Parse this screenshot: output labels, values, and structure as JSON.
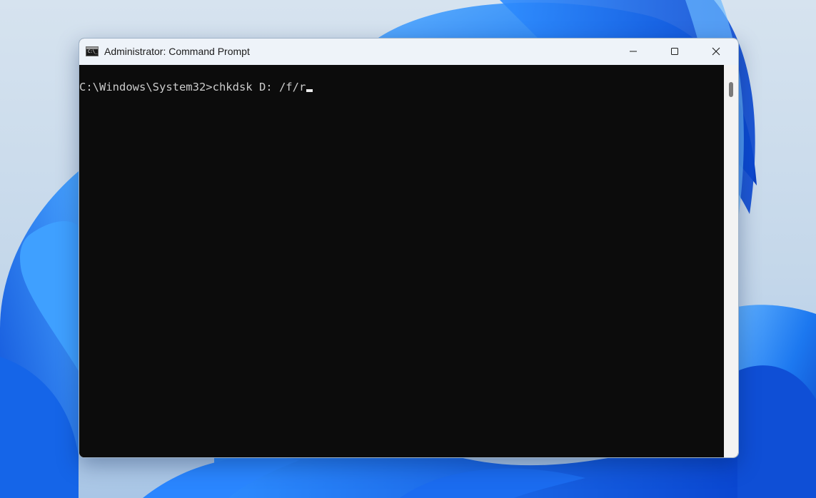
{
  "window": {
    "title": "Administrator: Command Prompt",
    "app_icon_text": "C:\\_"
  },
  "controls": {
    "minimize": "minimize-icon",
    "maximize": "maximize-icon",
    "close": "close-icon"
  },
  "console": {
    "prompt": "C:\\Windows\\System32>",
    "command": "chkdsk D: /f/r"
  },
  "colors": {
    "console_background": "#0c0c0c",
    "console_text": "#cccccc",
    "titlebar": "#eef3f9",
    "wallpaper_accent": "#1a6fe0"
  }
}
